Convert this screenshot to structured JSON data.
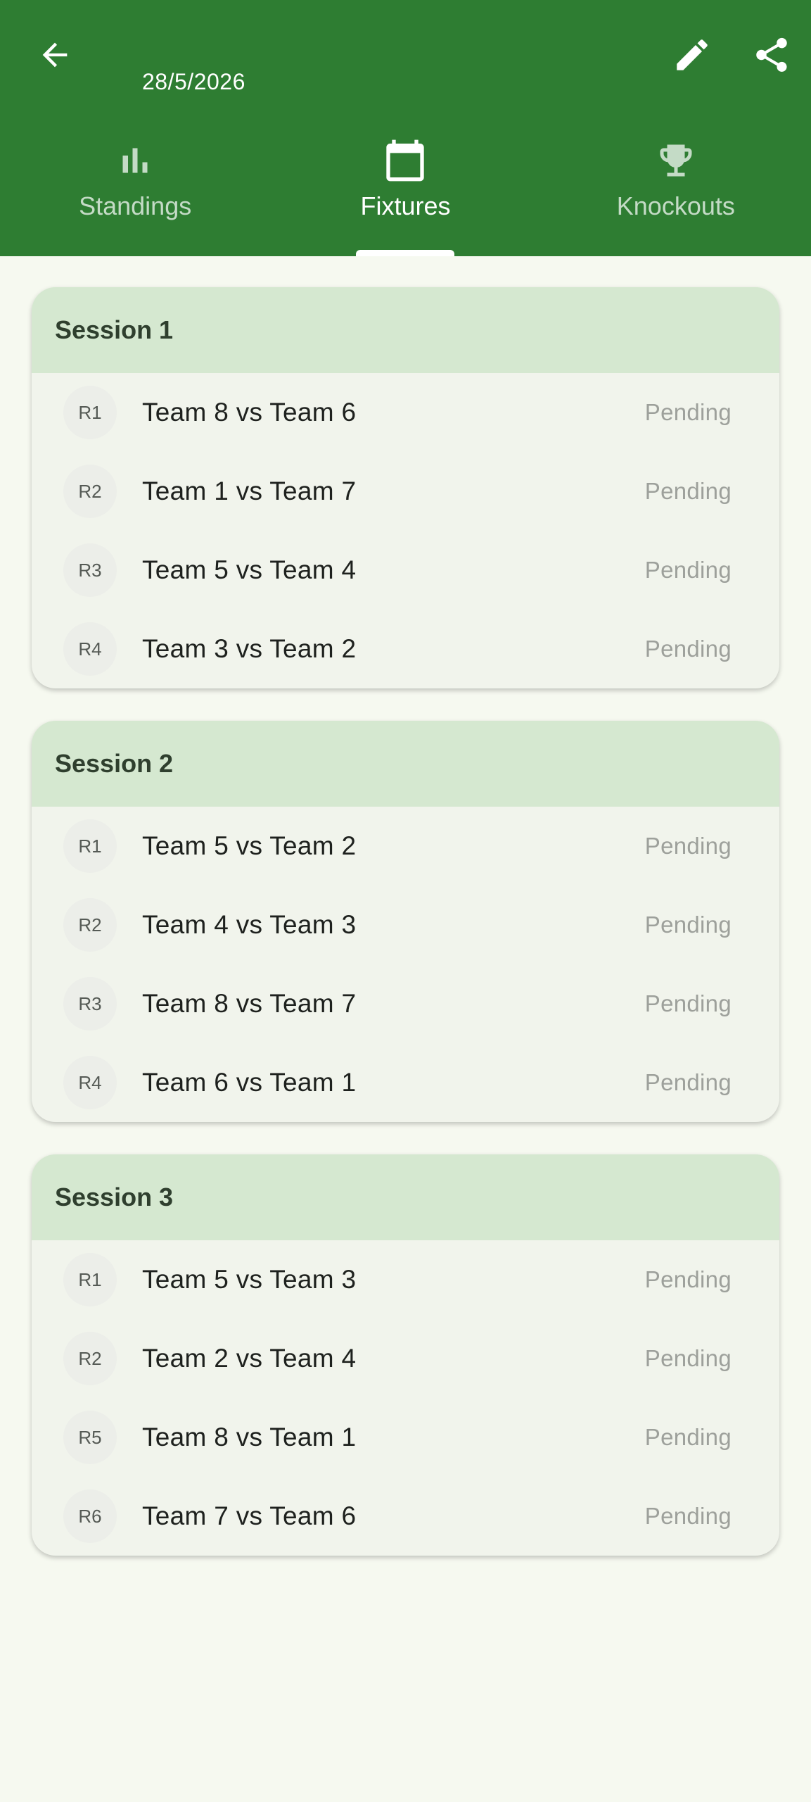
{
  "header": {
    "date": "28/5/2026",
    "icons": {
      "back": "arrow-back-icon",
      "edit": "pencil-icon",
      "share": "share-icon"
    },
    "colors": {
      "background": "#2E7D32",
      "foreground": "#FFFFFF"
    }
  },
  "tabs": [
    {
      "label": "Standings",
      "icon": "bar-chart-icon",
      "active": false
    },
    {
      "label": "Fixtures",
      "icon": "calendar-icon",
      "active": true
    },
    {
      "label": "Knockouts",
      "icon": "trophy-icon",
      "active": false
    }
  ],
  "sessions": [
    {
      "title": "Session 1",
      "matches": [
        {
          "round": "R1",
          "teams": "Team 8 vs Team 6",
          "status": "Pending"
        },
        {
          "round": "R2",
          "teams": "Team 1 vs Team 7",
          "status": "Pending"
        },
        {
          "round": "R3",
          "teams": "Team 5 vs Team 4",
          "status": "Pending"
        },
        {
          "round": "R4",
          "teams": "Team 3 vs Team 2",
          "status": "Pending"
        }
      ]
    },
    {
      "title": "Session 2",
      "matches": [
        {
          "round": "R1",
          "teams": "Team 5 vs Team 2",
          "status": "Pending"
        },
        {
          "round": "R2",
          "teams": "Team 4 vs Team 3",
          "status": "Pending"
        },
        {
          "round": "R3",
          "teams": "Team 8 vs Team 7",
          "status": "Pending"
        },
        {
          "round": "R4",
          "teams": "Team 6 vs Team 1",
          "status": "Pending"
        }
      ]
    },
    {
      "title": "Session 3",
      "matches": [
        {
          "round": "R1",
          "teams": "Team 5 vs Team 3",
          "status": "Pending"
        },
        {
          "round": "R2",
          "teams": "Team 2 vs Team 4",
          "status": "Pending"
        },
        {
          "round": "R5",
          "teams": "Team 8 vs Team 1",
          "status": "Pending"
        },
        {
          "round": "R6",
          "teams": "Team 7 vs Team 6",
          "status": "Pending"
        }
      ]
    }
  ],
  "colors": {
    "page_background": "#F6F9F0",
    "card_header": "#D5E8D0",
    "card_body": "#F1F4EC",
    "status_pending": "#9DA09B"
  }
}
